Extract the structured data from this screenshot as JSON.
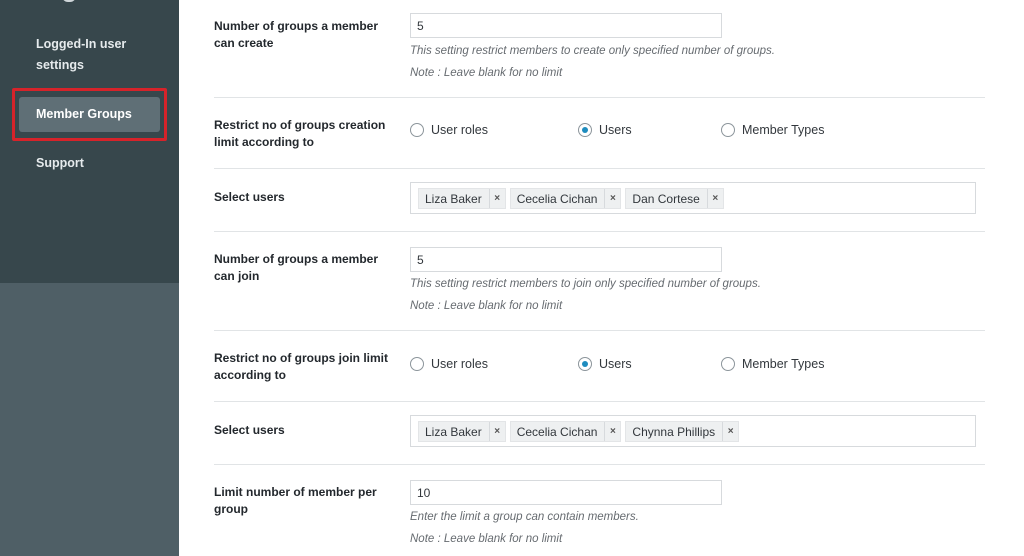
{
  "sidebar": {
    "items": [
      {
        "label": "Logged-In user settings"
      },
      {
        "label": "Member Groups",
        "active": true
      },
      {
        "label": "Support"
      }
    ]
  },
  "settings": {
    "create_limit": {
      "label": "Number of groups a member can create",
      "value": "5",
      "description": "This setting restrict members to create only specified number of groups.",
      "note": "Note : Leave blank for no limit"
    },
    "create_restrict": {
      "label": "Restrict no of groups creation limit according to",
      "options": [
        "User roles",
        "Users",
        "Member Types"
      ],
      "selected": "Users"
    },
    "create_users": {
      "label": "Select users",
      "tags": [
        "Liza Baker",
        "Cecelia Cichan",
        "Dan Cortese"
      ]
    },
    "join_limit": {
      "label": "Number of groups a member can join",
      "value": "5",
      "description": "This setting restrict members to join only specified number of groups.",
      "note": "Note : Leave blank for no limit"
    },
    "join_restrict": {
      "label": "Restrict no of groups join limit according to",
      "options": [
        "User roles",
        "Users",
        "Member Types"
      ],
      "selected": "Users"
    },
    "join_users": {
      "label": "Select users",
      "tags": [
        "Liza Baker",
        "Cecelia Cichan",
        "Chynna Phillips"
      ]
    },
    "member_limit": {
      "label": "Limit number of member per group",
      "value": "10",
      "description": "Enter the limit a group can contain members.",
      "note": "Note : Leave blank for no limit"
    }
  },
  "icons": {
    "remove_tag": "×"
  },
  "colors": {
    "sidebar_dark": "#37474c",
    "sidebar_light": "#4f5f66",
    "highlight": "#d6232a",
    "radio_checked": "#1e8cbe"
  }
}
